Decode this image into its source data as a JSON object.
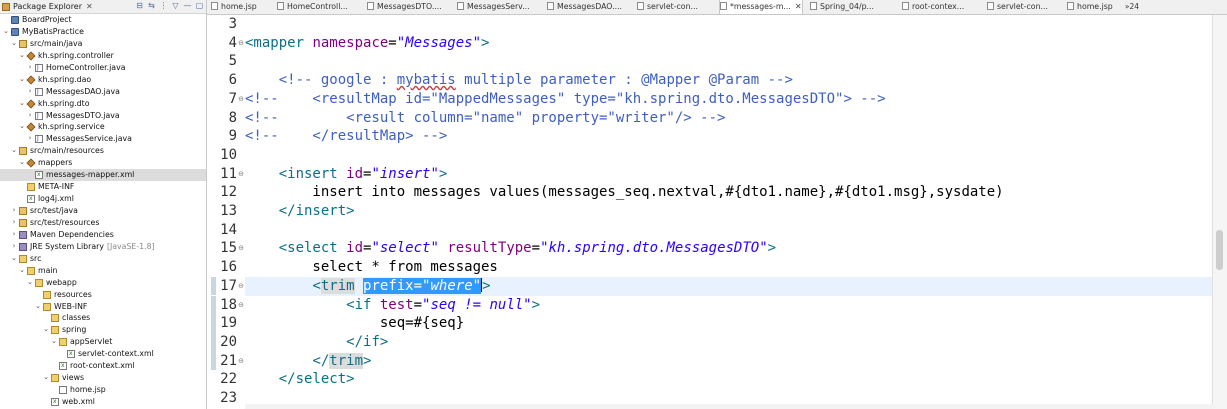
{
  "explorer": {
    "title": "Package Explorer",
    "close": "✕",
    "toolbar": [
      "⊟",
      "⇆",
      "⋮",
      "▽",
      "—",
      "▢"
    ],
    "tree": [
      {
        "depth": 0,
        "arrow": "",
        "icon": "project",
        "label": "BoardProject"
      },
      {
        "depth": 0,
        "arrow": "⌄",
        "icon": "project",
        "label": "MyBatisPractice"
      },
      {
        "depth": 1,
        "arrow": "⌄",
        "icon": "srcfolder",
        "label": "src/main/java"
      },
      {
        "depth": 2,
        "arrow": "⌄",
        "icon": "package",
        "label": "kh.spring.controller"
      },
      {
        "depth": 3,
        "arrow": "›",
        "icon": "javafile",
        "label": "HomeController.java"
      },
      {
        "depth": 2,
        "arrow": "⌄",
        "icon": "package",
        "label": "kh.spring.dao"
      },
      {
        "depth": 3,
        "arrow": "›",
        "icon": "javafile",
        "label": "MessagesDAO.java"
      },
      {
        "depth": 2,
        "arrow": "⌄",
        "icon": "package",
        "label": "kh.spring.dto"
      },
      {
        "depth": 3,
        "arrow": "›",
        "icon": "javafile",
        "label": "MessagesDTO.java"
      },
      {
        "depth": 2,
        "arrow": "⌄",
        "icon": "package",
        "label": "kh.spring.service"
      },
      {
        "depth": 3,
        "arrow": "›",
        "icon": "javafile",
        "label": "MessagesService.java"
      },
      {
        "depth": 1,
        "arrow": "⌄",
        "icon": "srcfolder",
        "label": "src/main/resources"
      },
      {
        "depth": 2,
        "arrow": "⌄",
        "icon": "package",
        "label": "mappers"
      },
      {
        "depth": 3,
        "arrow": "",
        "icon": "xmlfile",
        "label": "messages-mapper.xml",
        "selected": true
      },
      {
        "depth": 2,
        "arrow": "",
        "icon": "folder",
        "label": "META-INF"
      },
      {
        "depth": 2,
        "arrow": "",
        "icon": "xmlfile",
        "label": "log4j.xml"
      },
      {
        "depth": 1,
        "arrow": "›",
        "icon": "srcfolder",
        "label": "src/test/java"
      },
      {
        "depth": 1,
        "arrow": "›",
        "icon": "srcfolder",
        "label": "src/test/resources"
      },
      {
        "depth": 1,
        "arrow": "›",
        "icon": "library",
        "label": "Maven Dependencies"
      },
      {
        "depth": 1,
        "arrow": "›",
        "icon": "library",
        "label": "JRE System Library",
        "decoration": "[JavaSE-1.8]"
      },
      {
        "depth": 1,
        "arrow": "⌄",
        "icon": "folder",
        "label": "src"
      },
      {
        "depth": 2,
        "arrow": "⌄",
        "icon": "folder",
        "label": "main"
      },
      {
        "depth": 3,
        "arrow": "⌄",
        "icon": "folder",
        "label": "webapp"
      },
      {
        "depth": 4,
        "arrow": "",
        "icon": "folder",
        "label": "resources"
      },
      {
        "depth": 4,
        "arrow": "⌄",
        "icon": "folder",
        "label": "WEB-INF"
      },
      {
        "depth": 5,
        "arrow": "",
        "icon": "folder",
        "label": "classes"
      },
      {
        "depth": 5,
        "arrow": "⌄",
        "icon": "folder",
        "label": "spring"
      },
      {
        "depth": 6,
        "arrow": "⌄",
        "icon": "folder",
        "label": "appServlet"
      },
      {
        "depth": 7,
        "arrow": "",
        "icon": "xmlfile",
        "label": "servlet-context.xml"
      },
      {
        "depth": 6,
        "arrow": "",
        "icon": "xmlfile",
        "label": "root-context.xml"
      },
      {
        "depth": 5,
        "arrow": "⌄",
        "icon": "folder",
        "label": "views"
      },
      {
        "depth": 6,
        "arrow": "",
        "icon": "jspfile",
        "label": "home.jsp"
      },
      {
        "depth": 5,
        "arrow": "",
        "icon": "xmlfile",
        "label": "web.xml"
      }
    ]
  },
  "tabs": [
    {
      "label": "home.jsp"
    },
    {
      "label": "HomeControll..."
    },
    {
      "label": "MessagesDTO...."
    },
    {
      "label": "MessagesServ..."
    },
    {
      "label": "MessagesDAO...."
    },
    {
      "label": "servlet-con..."
    },
    {
      "label": "*messages-m...",
      "active": true,
      "close": "✕"
    },
    {
      "label": "Spring_04/p..."
    },
    {
      "label": "root-contex..."
    },
    {
      "label": "servlet-con..."
    },
    {
      "label": "home.jsp"
    }
  ],
  "tab_overflow": "»24",
  "editor": {
    "lines": [
      {
        "num": "3",
        "fold": "",
        "tokens": []
      },
      {
        "num": "4",
        "fold": "⊖",
        "tokens": [
          [
            "tag",
            "<mapper "
          ],
          [
            "attr",
            "namespace"
          ],
          [
            "plain",
            "="
          ],
          [
            "str",
            "\"Messages\""
          ],
          [
            "tag",
            ">"
          ]
        ]
      },
      {
        "num": "5",
        "fold": "",
        "tokens": []
      },
      {
        "num": "6",
        "fold": "",
        "tokens": [
          [
            "cmt",
            "    <!-- google : "
          ],
          [
            "cmtlink",
            "mybatis"
          ],
          [
            "cmt",
            " multiple parameter : @Mapper @Param -->"
          ]
        ]
      },
      {
        "num": "7",
        "fold": "⊖",
        "tokens": [
          [
            "cmt",
            "<!--    <resultMap id=\"MappedMessages\" type=\"kh.spring.dto.MessagesDTO\"> -->"
          ]
        ]
      },
      {
        "num": "8",
        "fold": "",
        "tokens": [
          [
            "cmt",
            "<!--        <result column=\"name\" property=\"writer\"/> -->"
          ]
        ]
      },
      {
        "num": "9",
        "fold": "",
        "tokens": [
          [
            "cmt",
            "<!--    </resultMap> -->"
          ]
        ]
      },
      {
        "num": "10",
        "fold": "",
        "tokens": []
      },
      {
        "num": "11",
        "fold": "⊖",
        "tokens": [
          [
            "plain",
            "    "
          ],
          [
            "tag",
            "<insert "
          ],
          [
            "attr",
            "id"
          ],
          [
            "plain",
            "="
          ],
          [
            "str",
            "\"insert\""
          ],
          [
            "tag",
            ">"
          ]
        ]
      },
      {
        "num": "12",
        "fold": "",
        "tokens": [
          [
            "plain",
            "        insert into messages values(messages_seq.nextval,#{dto1.name},#{dto1.msg},sysdate)"
          ]
        ]
      },
      {
        "num": "13",
        "fold": "",
        "tokens": [
          [
            "plain",
            "    "
          ],
          [
            "tag",
            "</insert>"
          ]
        ]
      },
      {
        "num": "14",
        "fold": "",
        "tokens": []
      },
      {
        "num": "15",
        "fold": "⊖",
        "tokens": [
          [
            "plain",
            "    "
          ],
          [
            "tag",
            "<select "
          ],
          [
            "attr",
            "id"
          ],
          [
            "plain",
            "="
          ],
          [
            "str",
            "\"select\""
          ],
          [
            "plain",
            " "
          ],
          [
            "attr",
            "resultType"
          ],
          [
            "plain",
            "="
          ],
          [
            "str",
            "\"kh.spring.dto.MessagesDTO\""
          ],
          [
            "tag",
            ">"
          ]
        ]
      },
      {
        "num": "16",
        "fold": "",
        "tokens": [
          [
            "plain",
            "        select * from messages"
          ]
        ]
      },
      {
        "num": "17",
        "fold": "⊖",
        "current": true,
        "change": true,
        "tokens": [
          [
            "plain",
            "        "
          ],
          [
            "tag",
            "<"
          ],
          [
            "tagmatch",
            "trim"
          ],
          [
            "plain",
            " "
          ],
          [
            "sel",
            "prefix="
          ],
          [
            "selstr",
            "\"where\""
          ],
          [
            "caret",
            ""
          ],
          [
            "tag",
            ">"
          ]
        ]
      },
      {
        "num": "18",
        "fold": "⊖",
        "change": true,
        "tokens": [
          [
            "plain",
            "            "
          ],
          [
            "tag",
            "<if "
          ],
          [
            "attr",
            "test"
          ],
          [
            "plain",
            "="
          ],
          [
            "str",
            "\"seq != null\""
          ],
          [
            "tag",
            ">"
          ]
        ]
      },
      {
        "num": "19",
        "fold": "",
        "change": true,
        "tokens": [
          [
            "plain",
            "                seq=#{seq}"
          ]
        ]
      },
      {
        "num": "20",
        "fold": "",
        "change": true,
        "tokens": [
          [
            "plain",
            "            "
          ],
          [
            "tag",
            "</if>"
          ]
        ]
      },
      {
        "num": "21",
        "fold": "⊖",
        "change": true,
        "tokens": [
          [
            "plain",
            "        "
          ],
          [
            "tag",
            "</"
          ],
          [
            "tagmatch",
            "trim"
          ],
          [
            "tag",
            ">"
          ]
        ]
      },
      {
        "num": "22",
        "fold": "",
        "tokens": [
          [
            "plain",
            "    "
          ],
          [
            "tag",
            "</select>"
          ]
        ]
      },
      {
        "num": "23",
        "fold": "",
        "tokens": []
      }
    ]
  }
}
